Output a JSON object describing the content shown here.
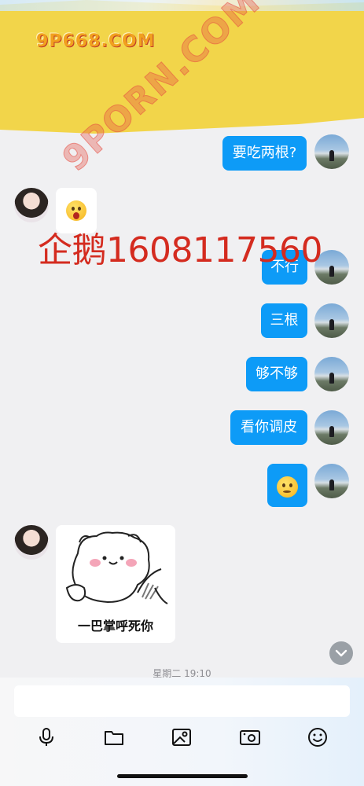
{
  "watermarks": {
    "top_logo": "9P668.COM",
    "diagonal": "9PORN.COM",
    "red_text": "企鹅1608117560"
  },
  "messages": [
    {
      "side": "right",
      "type": "text",
      "text": "要吃两根?"
    },
    {
      "side": "left",
      "type": "emoji",
      "emoji": "surprised-face"
    },
    {
      "side": "right",
      "type": "text",
      "text": "不行"
    },
    {
      "side": "right",
      "type": "text",
      "text": "三根"
    },
    {
      "side": "right",
      "type": "text",
      "text": "够不够"
    },
    {
      "side": "right",
      "type": "text",
      "text": "看你调皮"
    },
    {
      "side": "right",
      "type": "emoji",
      "emoji": "thinking-face"
    },
    {
      "side": "left",
      "type": "sticker",
      "caption": "一巴掌呼死你"
    }
  ],
  "timestamp": "星期二 19:10",
  "input": {
    "placeholder": ""
  },
  "toolbar": [
    "microphone-icon",
    "folder-icon",
    "image-icon",
    "camera-icon",
    "emoji-icon"
  ],
  "colors": {
    "bubble": "#0d9bf7",
    "banner": "#f2d54a",
    "watermark_red": "#d42b1f",
    "background": "#f0f0f2"
  }
}
